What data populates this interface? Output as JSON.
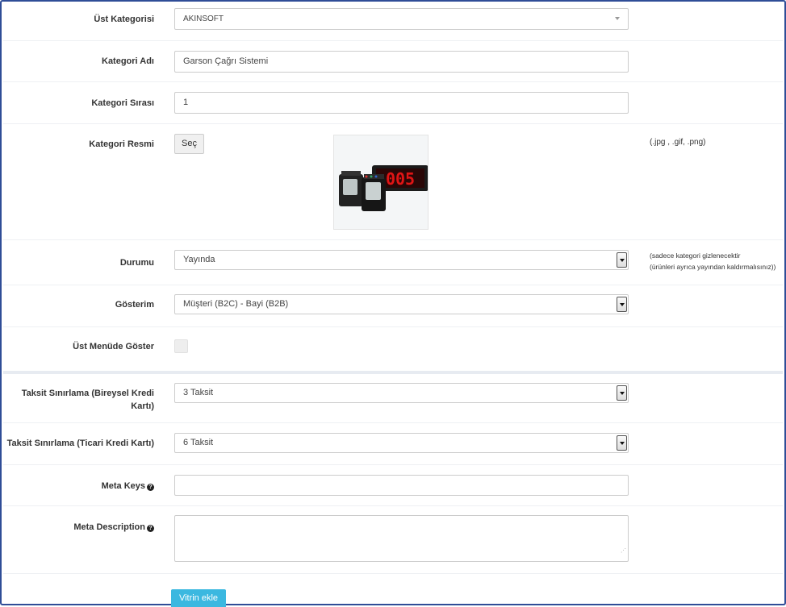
{
  "fields": {
    "parent_category": {
      "label": "Üst Kategorisi",
      "value": "AKINSOFT"
    },
    "category_name": {
      "label": "Kategori Adı",
      "value": "Garson Çağrı Sistemi"
    },
    "category_order": {
      "label": "Kategori Sırası",
      "value": "1"
    },
    "category_image": {
      "label": "Kategori Resmi",
      "choose_button": "Seç",
      "hint": "(.jpg , .gif, .png)",
      "preview_display_text": "005"
    },
    "status": {
      "label": "Durumu",
      "value": "Yayında",
      "hint_line1": "(sadece kategori gizlenecektir",
      "hint_line2": "(ürünleri ayrıca yayından kaldırmalısınız))"
    },
    "display": {
      "label": "Gösterim",
      "value": "Müşteri (B2C) - Bayi (B2B)"
    },
    "show_in_top_menu": {
      "label": "Üst Menüde Göster",
      "checked": false
    },
    "installment_individual": {
      "label_line1": "Taksit Sınırlama (Bireysel Kredi",
      "label_line2": "Kartı)",
      "value": "3 Taksit"
    },
    "installment_commercial": {
      "label": "Taksit Sınırlama (Ticari Kredi Kartı)",
      "value": "6 Taksit"
    },
    "meta_keys": {
      "label": "Meta Keys",
      "value": ""
    },
    "meta_description": {
      "label": "Meta Description",
      "value": ""
    }
  },
  "submit_button": "Vitrin ekle",
  "colors": {
    "frame_border": "#2f4d97",
    "submit_bg": "#3bb8e0"
  }
}
